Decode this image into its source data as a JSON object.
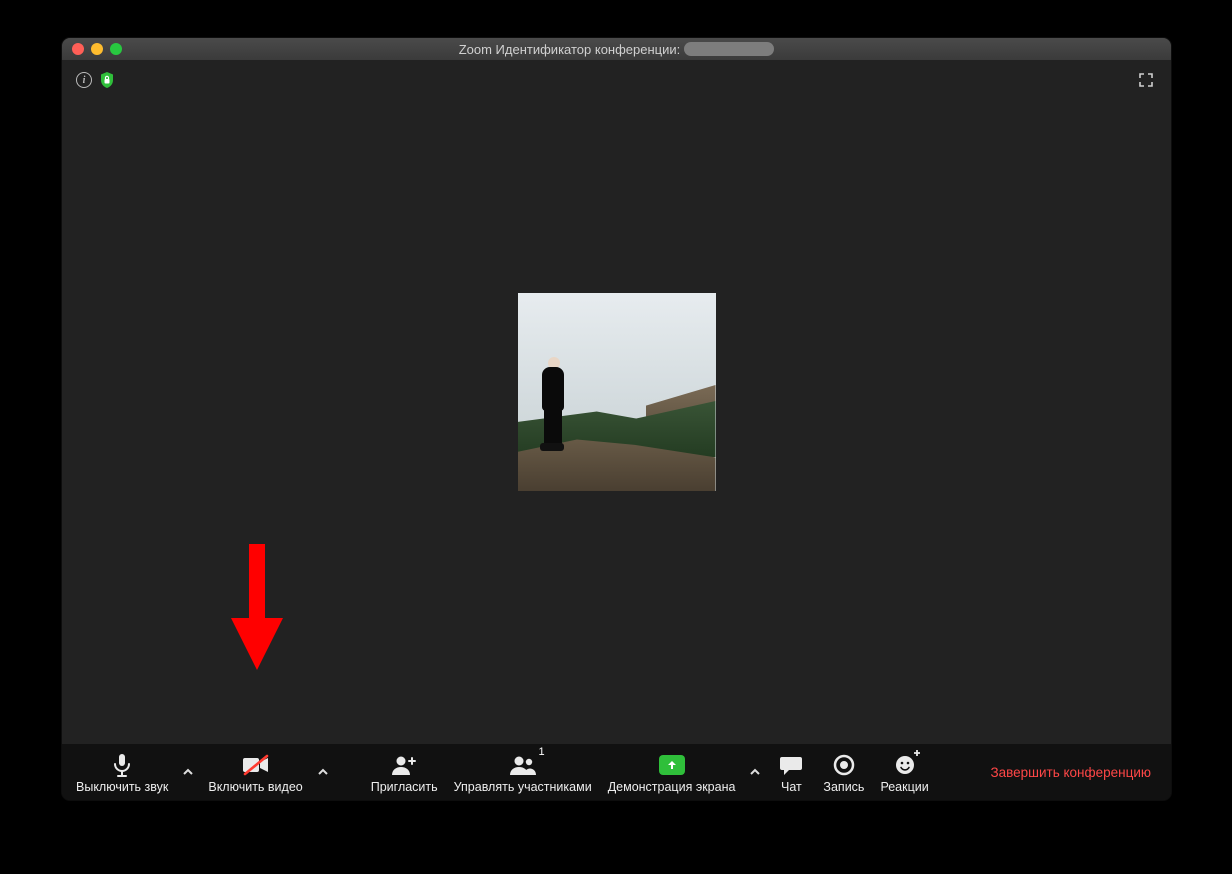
{
  "titlebar": {
    "title_prefix": "Zoom Идентификатор конференции:"
  },
  "toolbar": {
    "mute_label": "Выключить звук",
    "video_label": "Включить видео",
    "invite_label": "Пригласить",
    "participants_label": "Управлять участниками",
    "participants_count": "1",
    "share_label": "Демонстрация экрана",
    "chat_label": "Чат",
    "record_label": "Запись",
    "reactions_label": "Реакции",
    "end_label": "Завершить конференцию"
  },
  "colors": {
    "accent_green": "#2fbf3a",
    "danger_red": "#ff4747",
    "arrow_red": "#ff0000"
  }
}
